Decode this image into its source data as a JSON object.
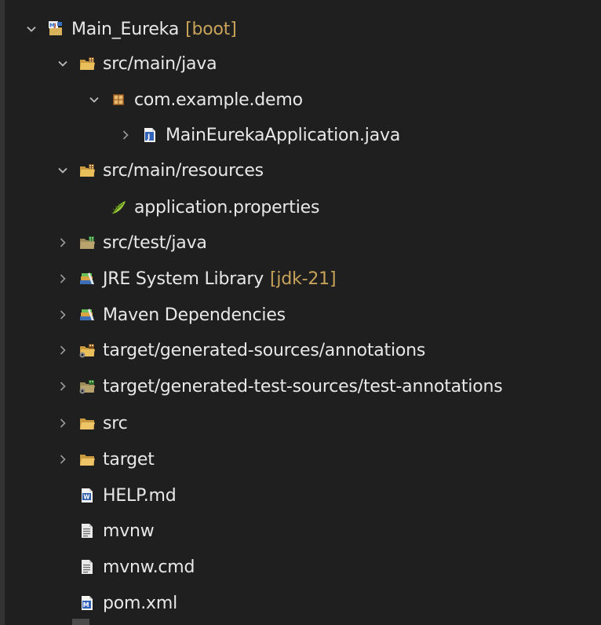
{
  "tree": {
    "items": [
      {
        "name": "project-main-eureka",
        "icon": "maven-project-icon",
        "label": "Main_Eureka",
        "decoration": "[boot]",
        "state": "expanded"
      },
      {
        "name": "src-main-java",
        "icon": "source-folder-icon",
        "label": "src/main/java",
        "decoration": "",
        "state": "expanded"
      },
      {
        "name": "package-com-example-demo",
        "icon": "package-icon",
        "label": "com.example.demo",
        "decoration": "",
        "state": "expanded"
      },
      {
        "name": "main-eureka-application-java",
        "icon": "java-file-icon",
        "label": "MainEurekaApplication.java",
        "decoration": "",
        "state": "collapsed"
      },
      {
        "name": "src-main-resources",
        "icon": "source-folder-icon",
        "label": "src/main/resources",
        "decoration": "",
        "state": "expanded"
      },
      {
        "name": "application-properties",
        "icon": "properties-file-icon",
        "label": "application.properties",
        "decoration": "",
        "state": "leaf"
      },
      {
        "name": "src-test-java",
        "icon": "test-source-folder-icon",
        "label": "src/test/java",
        "decoration": "",
        "state": "collapsed"
      },
      {
        "name": "jre-system-library",
        "icon": "library-icon",
        "label": "JRE System Library",
        "decoration": "[jdk-21]",
        "state": "collapsed"
      },
      {
        "name": "maven-dependencies",
        "icon": "library-icon",
        "label": "Maven Dependencies",
        "decoration": "",
        "state": "collapsed"
      },
      {
        "name": "target-generated-sources",
        "icon": "generated-source-folder-icon",
        "label": "target/generated-sources/annotations",
        "decoration": "",
        "state": "collapsed"
      },
      {
        "name": "target-generated-test-sources",
        "icon": "generated-test-source-folder-icon",
        "label": "target/generated-test-sources/test-annotations",
        "decoration": "",
        "state": "collapsed"
      },
      {
        "name": "folder-src",
        "icon": "folder-icon",
        "label": "src",
        "decoration": "",
        "state": "collapsed"
      },
      {
        "name": "folder-target",
        "icon": "folder-icon",
        "label": "target",
        "decoration": "",
        "state": "collapsed"
      },
      {
        "name": "help-md",
        "icon": "markdown-file-icon",
        "label": "HELP.md",
        "decoration": "",
        "state": "leaf"
      },
      {
        "name": "mvnw",
        "icon": "text-file-icon",
        "label": "mvnw",
        "decoration": "",
        "state": "leaf"
      },
      {
        "name": "mvnw-cmd",
        "icon": "text-file-icon",
        "label": "mvnw.cmd",
        "decoration": "",
        "state": "leaf"
      },
      {
        "name": "pom-xml",
        "icon": "maven-pom-icon",
        "label": "pom.xml",
        "decoration": "",
        "state": "leaf"
      }
    ]
  },
  "colors": {
    "background": "#1f1f1f",
    "text": "#e8e8e8",
    "decoration": "#c8a35a",
    "chevron": "#bdbdbd"
  }
}
